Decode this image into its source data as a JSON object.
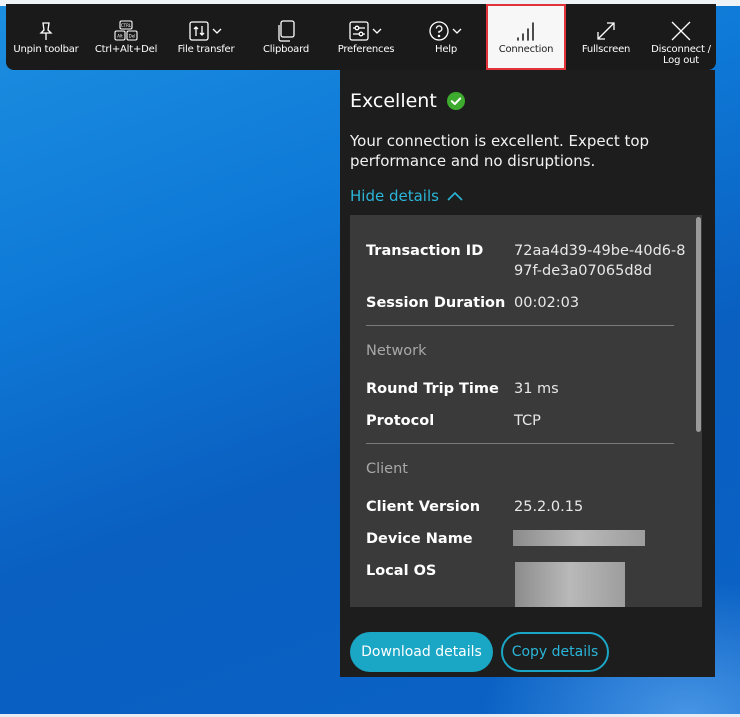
{
  "toolbar": {
    "items": [
      {
        "label": "Unpin toolbar",
        "icon": "pin-icon"
      },
      {
        "label": "Ctrl+Alt+Del",
        "icon": "keyboard-keys-icon"
      },
      {
        "label": "File transfer",
        "icon": "file-transfer-icon"
      },
      {
        "label": "Clipboard",
        "icon": "clipboard-icon"
      },
      {
        "label": "Preferences",
        "icon": "preferences-sliders-icon"
      },
      {
        "label": "Help",
        "icon": "help-icon"
      },
      {
        "label": "Connection",
        "icon": "signal-bars-icon",
        "active": true
      },
      {
        "label": "Fullscreen",
        "icon": "fullscreen-icon"
      },
      {
        "label": "Disconnect /\nLog out",
        "icon": "close-icon"
      }
    ],
    "key_caps": {
      "top": "CTRL",
      "left": "Alt",
      "right": "Del"
    }
  },
  "panel": {
    "status_title": "Excellent",
    "status_description": "Your connection is excellent. Expect top performance and no disruptions.",
    "hide_details_label": "Hide details",
    "details": {
      "transaction_id_label": "Transaction ID",
      "transaction_id_value": "72aa4d39-49be-40d6-897f-de3a07065d8d",
      "session_duration_label": "Session Duration",
      "session_duration_value": "00:02:03",
      "network_section": "Network",
      "round_trip_label": "Round Trip Time",
      "round_trip_value": "31 ms",
      "protocol_label": "Protocol",
      "protocol_value": "TCP",
      "client_section": "Client",
      "client_version_label": "Client Version",
      "client_version_value": "25.2.0.15",
      "device_name_label": "Device Name",
      "local_os_label": "Local OS"
    },
    "download_button": "Download details",
    "copy_button": "Copy details"
  },
  "colors": {
    "accent": "#1aa6c5",
    "success": "#3dab2e",
    "toolbar_bg": "#1a1a1a",
    "active_outline": "#e2323a"
  }
}
